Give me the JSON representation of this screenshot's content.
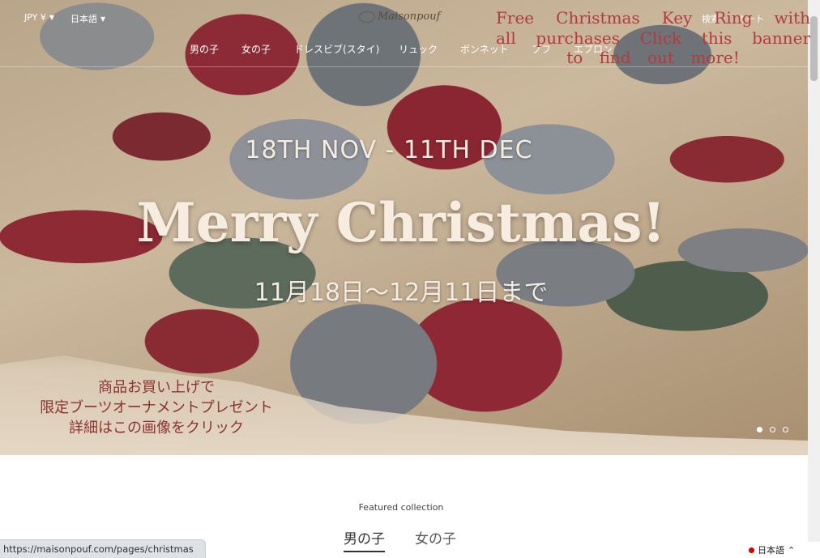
{
  "header": {
    "currency": "JPY ¥",
    "language": "日本語",
    "logo_text": "Maisonpouf",
    "right_link_1": "検索",
    "right_link_2": "カート"
  },
  "nav": {
    "items": [
      "男の子",
      "女の子",
      "ドレスビブ(スタイ)",
      "リュック",
      "ボンネット",
      "ブフ",
      "エプロン"
    ]
  },
  "free_banner": {
    "text": "Free Christmas Key Ring with all purchases Click this banner to find out more!"
  },
  "hero": {
    "dates_en": "18TH NOV - 11TH DEC",
    "title": "Merry Christmas!",
    "dates_jp": "11月18日〜12月11日まで",
    "promo_line1": "商品お買い上げで",
    "promo_line2": "限定ブーツオーナメントプレゼント",
    "promo_line3": "詳細はこの画像をクリック",
    "slide_count": 3,
    "active_slide": 1
  },
  "featured": {
    "label": "Featured collection",
    "tabs": [
      "男の子",
      "女の子"
    ],
    "active_tab": "男の子"
  },
  "status_bar": {
    "url": "https://maisonpouf.com/pages/christmas"
  },
  "lang_switch": {
    "label": "日本語"
  },
  "colors": {
    "banner_text": "#b23b3b",
    "promo_text": "#8c3330",
    "hero_text": "#f6ede0"
  }
}
